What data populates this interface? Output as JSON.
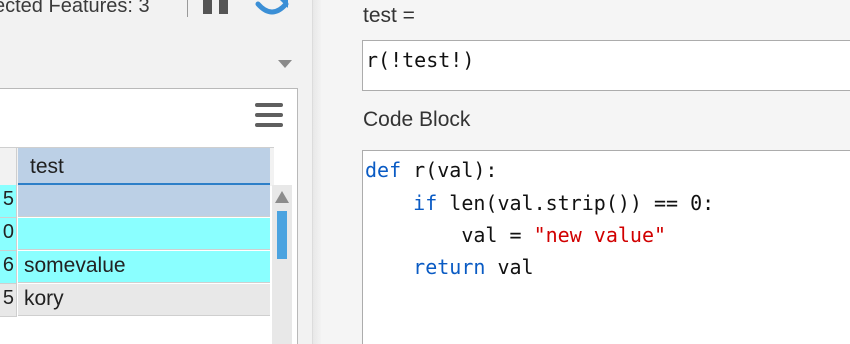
{
  "toolbar": {
    "selected_label": "ected Features: 3"
  },
  "grid": {
    "column_header": "test",
    "rows": [
      {
        "id": "5",
        "value": ""
      },
      {
        "id": "0",
        "value": ""
      },
      {
        "id": "6",
        "value": "somevalue"
      },
      {
        "id": "5",
        "value": "kory"
      }
    ]
  },
  "calculate": {
    "field_label": "test =",
    "expression": "r(!test!)",
    "code_block_label": "Code Block",
    "code": {
      "line1_kw": "def",
      "line1_rest": " r(val):",
      "line2_indent": "    ",
      "line2_kw": "if",
      "line2_rest": " len(val.strip()) == 0:",
      "line3_prefix": "        val = ",
      "line3_str": "\"new value\"",
      "line4_indent": "    ",
      "line4_kw": "return",
      "line4_rest": " val"
    }
  },
  "icons": {
    "pause": "pause-icon",
    "refresh": "refresh-icon",
    "dropdown": "chevron-down-icon",
    "menu": "hamburger-menu-icon",
    "scroll_up": "scroll-up-icon"
  },
  "colors": {
    "highlight_cyan": "#8affff",
    "selected_blue": "#bcd0e6",
    "accent_blue": "#2d7fc8",
    "keyword": "#0a5bc4",
    "string": "#d10000"
  }
}
